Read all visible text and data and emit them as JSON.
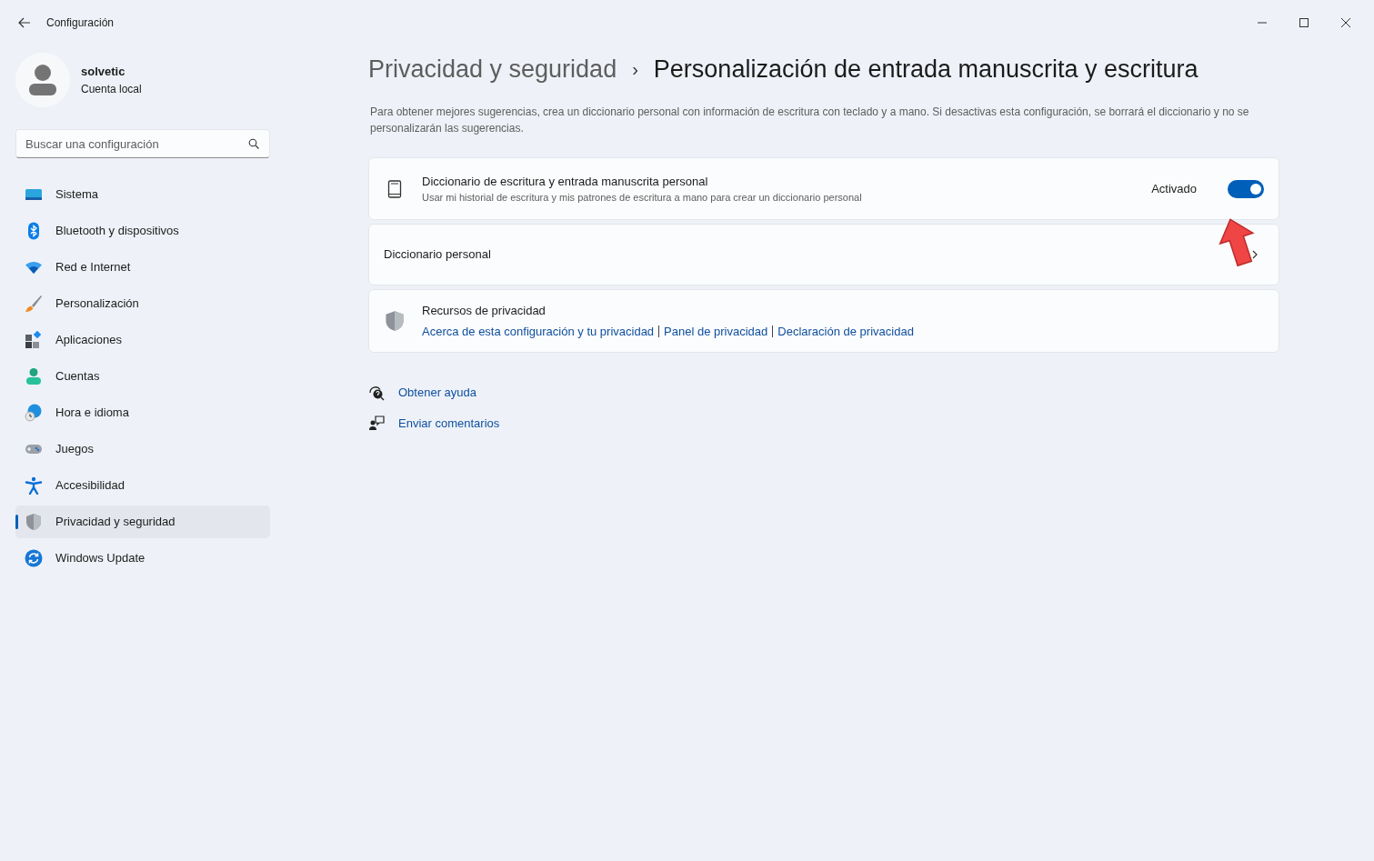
{
  "window": {
    "title": "Configuración"
  },
  "user": {
    "name": "solvetic",
    "account": "Cuenta local"
  },
  "search": {
    "placeholder": "Buscar una configuración"
  },
  "sidebar": {
    "items": [
      {
        "label": "Sistema",
        "kind": "system",
        "selected": false
      },
      {
        "label": "Bluetooth y dispositivos",
        "kind": "bluetooth",
        "selected": false
      },
      {
        "label": "Red e Internet",
        "kind": "wifi",
        "selected": false
      },
      {
        "label": "Personalización",
        "kind": "brush",
        "selected": false
      },
      {
        "label": "Aplicaciones",
        "kind": "apps",
        "selected": false
      },
      {
        "label": "Cuentas",
        "kind": "person",
        "selected": false
      },
      {
        "label": "Hora e idioma",
        "kind": "globe",
        "selected": false
      },
      {
        "label": "Juegos",
        "kind": "gamepad",
        "selected": false
      },
      {
        "label": "Accesibilidad",
        "kind": "accessibility",
        "selected": false
      },
      {
        "label": "Privacidad y seguridad",
        "kind": "shield",
        "selected": true
      },
      {
        "label": "Windows Update",
        "kind": "update",
        "selected": false
      }
    ]
  },
  "breadcrumb": {
    "parent": "Privacidad y seguridad",
    "separator": "›",
    "current": "Personalización de entrada manuscrita y escritura"
  },
  "description": "Para obtener mejores sugerencias, crea un diccionario personal con información de escritura con teclado y a mano. Si desactivas esta configuración, se borrará el diccionario y no se personalizarán las sugerencias.",
  "settings": [
    {
      "kind": "toggle",
      "title": "Diccionario de escritura y entrada manuscrita personal",
      "subtitle": "Usar mi historial de escritura y mis patrones de escritura a mano para crear un diccionario personal",
      "state_label": "Activado",
      "on": true
    },
    {
      "kind": "link",
      "title": "Diccionario personal"
    },
    {
      "kind": "resources",
      "title": "Recursos de privacidad",
      "links": [
        "Acerca de esta configuración y tu privacidad",
        "Panel de privacidad",
        "Declaración de privacidad"
      ]
    }
  ],
  "help_links": [
    {
      "label": "Obtener ayuda",
      "kind": "help"
    },
    {
      "label": "Enviar comentarios",
      "kind": "feedback"
    }
  ]
}
